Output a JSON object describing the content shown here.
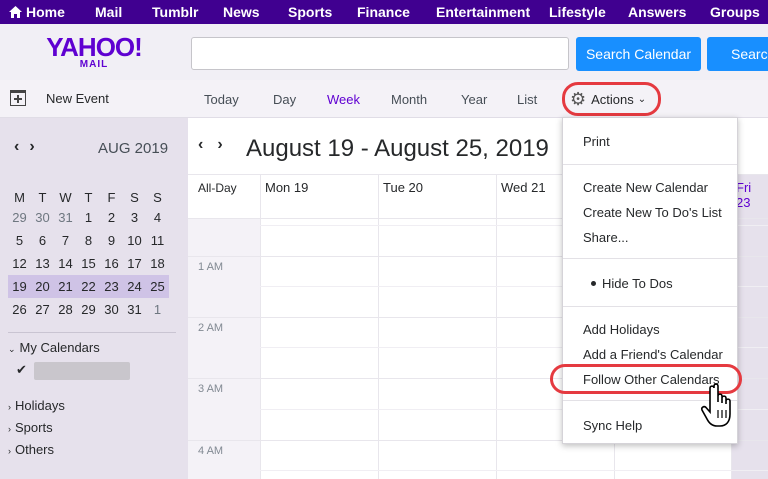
{
  "topnav": {
    "items": [
      "Home",
      "Mail",
      "Tumblr",
      "News",
      "Sports",
      "Finance",
      "Entertainment",
      "Lifestyle",
      "Answers",
      "Groups"
    ]
  },
  "header": {
    "logo_main": "YAHOO!",
    "logo_sub": "MAIL",
    "search_value": "",
    "search_calendar_label": "Search Calendar",
    "search_web_label": "Search"
  },
  "toolbar": {
    "new_event_label": "New Event",
    "views": [
      "Today",
      "Day",
      "Week",
      "Month",
      "Year",
      "List"
    ],
    "active_view": "Week",
    "actions_label": "Actions"
  },
  "mini_calendar": {
    "month_label": "AUG 2019",
    "weekday_headers": [
      "M",
      "T",
      "W",
      "T",
      "F",
      "S",
      "S"
    ],
    "weeks": [
      [
        "29",
        "30",
        "31",
        "1",
        "2",
        "3",
        "4"
      ],
      [
        "5",
        "6",
        "7",
        "8",
        "9",
        "10",
        "11"
      ],
      [
        "12",
        "13",
        "14",
        "15",
        "16",
        "17",
        "18"
      ],
      [
        "19",
        "20",
        "21",
        "22",
        "23",
        "24",
        "25"
      ],
      [
        "26",
        "27",
        "28",
        "29",
        "30",
        "31",
        "1"
      ]
    ],
    "today": "23"
  },
  "sidebar": {
    "my_calendars_label": "My Calendars",
    "check_mark": "✔",
    "sections": [
      "Holidays",
      "Sports",
      "Others"
    ]
  },
  "week_view": {
    "title": "August 19 - August 25, 2019",
    "all_day_label": "All-Day",
    "day_headers": [
      "Mon 19",
      "Tue 20",
      "Wed 21",
      "Fri 23"
    ],
    "hour_labels": [
      "1 AM",
      "2 AM",
      "3 AM",
      "4 AM"
    ]
  },
  "actions_menu": {
    "items": [
      "Print",
      "Create New Calendar",
      "Create New To Do's List",
      "Share...",
      "Hide To Dos",
      "Add Holidays",
      "Add a Friend's Calendar",
      "Follow Other Calendars",
      "Sync Help"
    ],
    "highlighted_item": "Follow Other Calendars"
  },
  "colors": {
    "nav_purple": "#400090",
    "brand_purple": "#5f01d1",
    "button_blue": "#188fff",
    "highlight_red": "#e53a40"
  }
}
